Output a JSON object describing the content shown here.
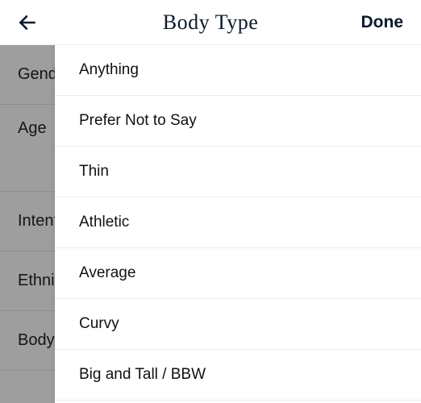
{
  "header": {
    "title": "Body Type",
    "done_label": "Done"
  },
  "filters": {
    "items": [
      {
        "label": "Gender"
      },
      {
        "label": "Age"
      },
      {
        "label": "Intent"
      },
      {
        "label": "Ethnicity"
      },
      {
        "label": "Body Type"
      }
    ]
  },
  "sheet": {
    "options": [
      "Anything",
      "Prefer Not to Say",
      "Thin",
      "Athletic",
      "Average",
      "Curvy",
      "Big and Tall / BBW"
    ]
  }
}
